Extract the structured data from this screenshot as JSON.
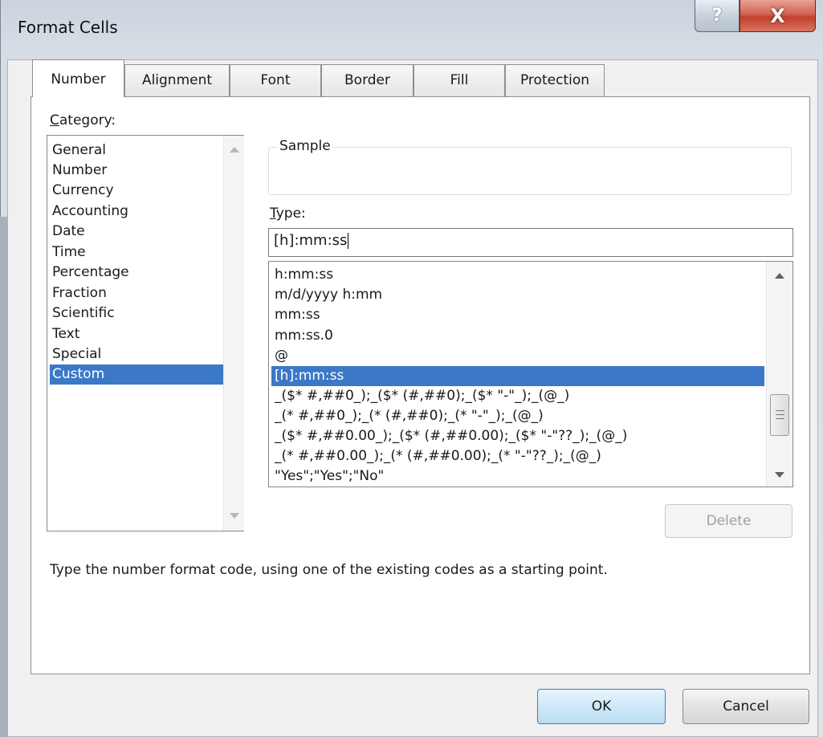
{
  "window": {
    "title": "Format Cells",
    "help_glyph": "?",
    "close_glyph": "X"
  },
  "tabs": [
    {
      "label": "Number",
      "active": true
    },
    {
      "label": "Alignment"
    },
    {
      "label": "Font"
    },
    {
      "label": "Border"
    },
    {
      "label": "Fill"
    },
    {
      "label": "Protection"
    }
  ],
  "category": {
    "label_first": "C",
    "label_rest": "ategory:",
    "items": [
      "General",
      "Number",
      "Currency",
      "Accounting",
      "Date",
      "Time",
      "Percentage",
      "Fraction",
      "Scientific",
      "Text",
      "Special",
      "Custom"
    ],
    "selected": "Custom"
  },
  "sample": {
    "label": "Sample",
    "value": ""
  },
  "type": {
    "label_first": "T",
    "label_rest": "ype:",
    "value": "[h]:mm:ss",
    "items": [
      "h:mm:ss",
      "m/d/yyyy h:mm",
      "mm:ss",
      "mm:ss.0",
      "@",
      "[h]:mm:ss",
      "_($* #,##0_);_($* (#,##0);_($* \"-\"_);_(@_)",
      "_(* #,##0_);_(* (#,##0);_(* \"-\"_);_(@_)",
      "_($* #,##0.00_);_($* (#,##0.00);_($* \"-\"??_);_(@_)",
      "_(* #,##0.00_);_(* (#,##0.00);_(* \"-\"??_);_(@_)",
      "\"Yes\";\"Yes\";\"No\""
    ],
    "selected": "[h]:mm:ss"
  },
  "buttons": {
    "delete": "Delete",
    "ok": "OK",
    "cancel": "Cancel"
  },
  "hint": "Type the number format code, using one of the existing codes as a starting point.",
  "colors": {
    "selection": "#3c78c8",
    "close_red": "#c2412d"
  },
  "icons": {
    "help": "help-icon",
    "close": "close-icon",
    "scroll_up": "arrow-up-icon",
    "scroll_down": "arrow-down-icon",
    "grip": "grip-icon"
  }
}
